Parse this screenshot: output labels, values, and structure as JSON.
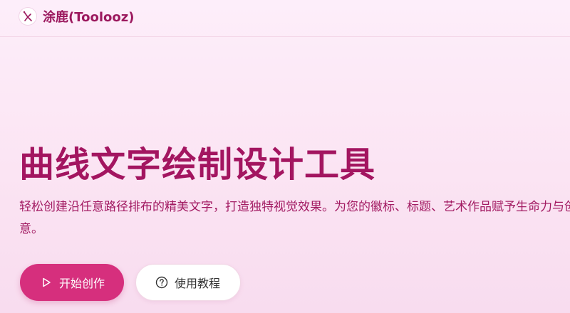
{
  "header": {
    "brand_name": "涂鹿(Toolooz)",
    "logo_icon": "crane-logo-icon"
  },
  "hero": {
    "title": "曲线文字绘制设计工具",
    "description": "轻松创建沿任意路径排布的精美文字，打造独特视觉效果。为您的徽标、标题、艺术作品赋予生命力与创意。"
  },
  "actions": {
    "primary_label": "开始创作",
    "primary_icon": "play-icon",
    "secondary_label": "使用教程",
    "secondary_icon": "question-circle-icon"
  },
  "colors": {
    "accent": "#d62f7d",
    "title": "#a31560",
    "background": "#fdeefa"
  }
}
